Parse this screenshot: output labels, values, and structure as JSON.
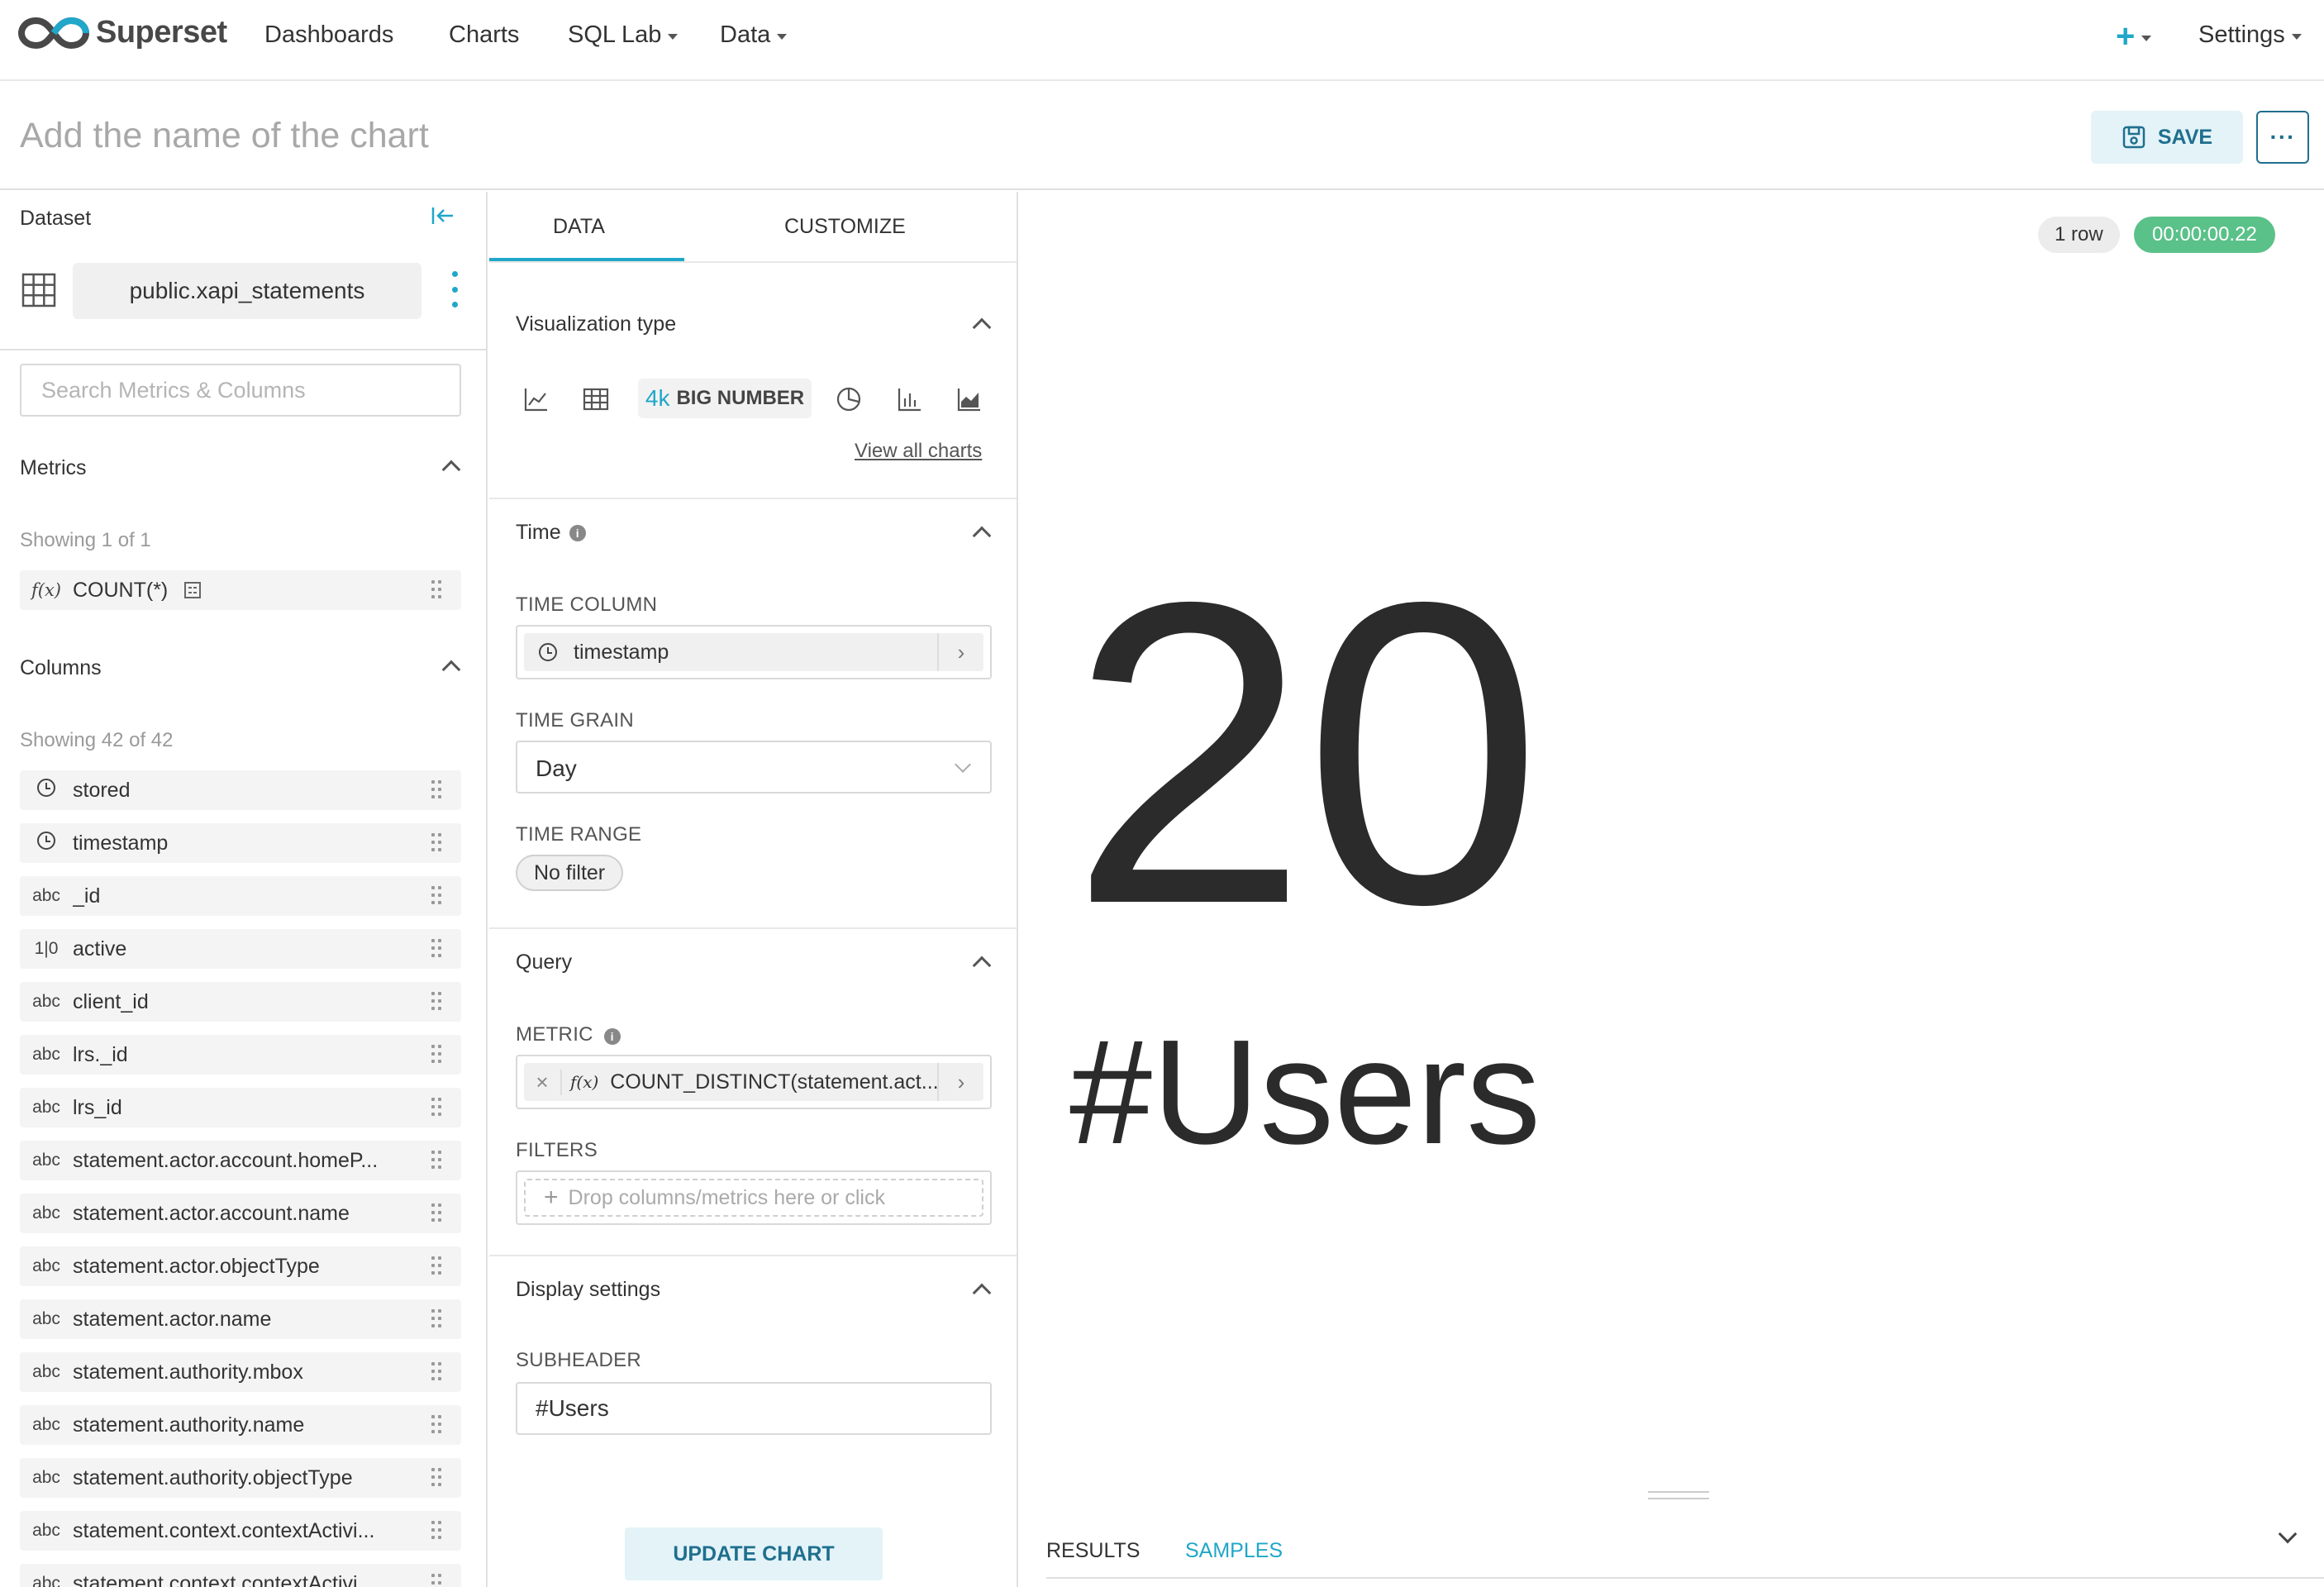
{
  "nav": {
    "brand": "Superset",
    "items": [
      "Dashboards",
      "Charts",
      "SQL Lab",
      "Data"
    ],
    "settings": "Settings"
  },
  "header": {
    "chart_name_placeholder": "Add the name of the chart",
    "save_label": "SAVE"
  },
  "dataset": {
    "label": "Dataset",
    "name": "public.xapi_statements",
    "search_placeholder": "Search Metrics & Columns",
    "metrics_title": "Metrics",
    "metrics_showing": "Showing 1 of 1",
    "metrics": [
      {
        "type": "f(x)",
        "name": "COUNT(*)"
      }
    ],
    "columns_title": "Columns",
    "columns_showing": "Showing 42 of 42",
    "columns": [
      {
        "type": "time",
        "name": "stored"
      },
      {
        "type": "time",
        "name": "timestamp"
      },
      {
        "type": "abc",
        "name": "_id"
      },
      {
        "type": "1|0",
        "name": "active"
      },
      {
        "type": "abc",
        "name": "client_id"
      },
      {
        "type": "abc",
        "name": "lrs._id"
      },
      {
        "type": "abc",
        "name": "lrs_id"
      },
      {
        "type": "abc",
        "name": "statement.actor.account.homeP..."
      },
      {
        "type": "abc",
        "name": "statement.actor.account.name"
      },
      {
        "type": "abc",
        "name": "statement.actor.objectType"
      },
      {
        "type": "abc",
        "name": "statement.actor.name"
      },
      {
        "type": "abc",
        "name": "statement.authority.mbox"
      },
      {
        "type": "abc",
        "name": "statement.authority.name"
      },
      {
        "type": "abc",
        "name": "statement.authority.objectType"
      },
      {
        "type": "abc",
        "name": "statement.context.contextActivi..."
      },
      {
        "type": "abc",
        "name": "statement.context.contextActivi..."
      }
    ]
  },
  "controls": {
    "tab_data": "DATA",
    "tab_customize": "CUSTOMIZE",
    "viz_title": "Visualization type",
    "viz_selected_icon": "4k",
    "viz_selected": "BIG NUMBER",
    "view_all": "View all charts",
    "time_title": "Time",
    "time_column_label": "TIME COLUMN",
    "time_column_value": "timestamp",
    "time_grain_label": "TIME GRAIN",
    "time_grain_value": "Day",
    "time_range_label": "TIME RANGE",
    "time_range_value": "No filter",
    "query_title": "Query",
    "metric_label": "METRIC",
    "metric_value": "COUNT_DISTINCT(statement.act...",
    "filters_label": "FILTERS",
    "filters_placeholder": "Drop columns/metrics here or click",
    "display_title": "Display settings",
    "subheader_label": "SUBHEADER",
    "subheader_value": "#Users",
    "update_label": "UPDATE CHART"
  },
  "result": {
    "row_count": "1 row",
    "duration": "00:00:00.22",
    "big_number": "20",
    "subheader": "#Users",
    "tab_results": "RESULTS",
    "tab_samples": "SAMPLES"
  },
  "colors": {
    "accent": "#20a7c9",
    "primary_dark": "#1f6f8e",
    "success": "#5ac189"
  }
}
